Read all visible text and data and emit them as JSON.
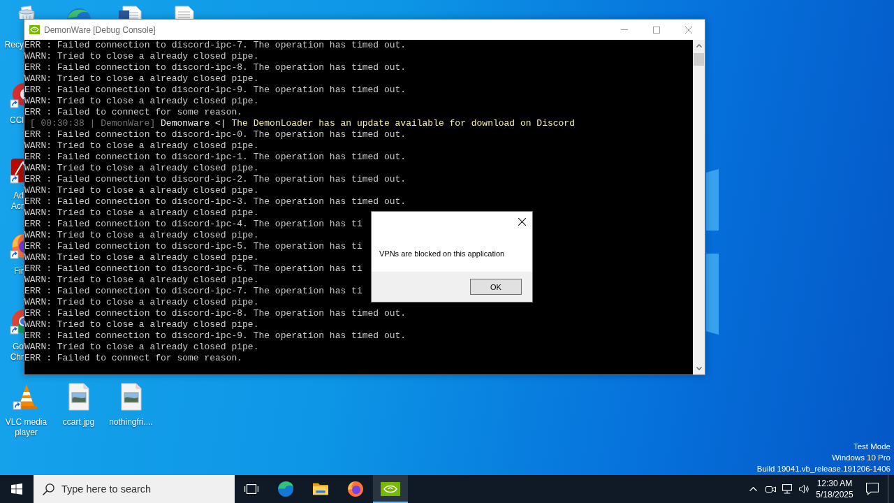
{
  "desktop": {
    "icons": [
      {
        "kind": "recycle-bin",
        "label": "Recy"
      },
      {
        "kind": "edge"
      },
      {
        "kind": "word-document"
      },
      {
        "kind": "text-document"
      },
      {
        "kind": "ccleaner",
        "label": "CCl"
      },
      {
        "kind": "acrobat",
        "label": "Ad Acr"
      },
      {
        "kind": "firefox",
        "label": "Fir"
      },
      {
        "kind": "chrome",
        "label": "Go Chr"
      },
      {
        "kind": "vlc",
        "label": "VLC media player"
      },
      {
        "kind": "image-file",
        "label": "ccart.jpg"
      },
      {
        "kind": "image-file",
        "label": "nothingfri...."
      }
    ],
    "system_info": [
      "Test Mode",
      "Windows 10 Pro",
      "Build 19041.vb_release.191206-1406"
    ]
  },
  "console_window": {
    "title": "DemonWare [Debug Console]",
    "lines": [
      {
        "kind": "log",
        "text": "ERR : Failed connection to discord-ipc-7. The operation has timed out."
      },
      {
        "kind": "log",
        "text": "WARN: Tried to close a already closed pipe."
      },
      {
        "kind": "log",
        "text": "ERR : Failed connection to discord-ipc-8. The operation has timed out."
      },
      {
        "kind": "log",
        "text": "WARN: Tried to close a already closed pipe."
      },
      {
        "kind": "log",
        "text": "ERR : Failed connection to discord-ipc-9. The operation has timed out."
      },
      {
        "kind": "log",
        "text": "WARN: Tried to close a already closed pipe."
      },
      {
        "kind": "log",
        "text": "ERR : Failed to connect for some reason."
      },
      {
        "kind": "notice",
        "timestamp": "[ 00:30:38 | DemonWare]",
        "source": "Demonware <|",
        "message": "The DemonLoader has an update available for download on Discord"
      },
      {
        "kind": "log",
        "text": "ERR : Failed connection to discord-ipc-0. The operation has timed out."
      },
      {
        "kind": "log",
        "text": "WARN: Tried to close a already closed pipe."
      },
      {
        "kind": "log",
        "text": "ERR : Failed connection to discord-ipc-1. The operation has timed out."
      },
      {
        "kind": "log",
        "text": "WARN: Tried to close a already closed pipe."
      },
      {
        "kind": "log",
        "text": "ERR : Failed connection to discord-ipc-2. The operation has timed out."
      },
      {
        "kind": "log",
        "text": "WARN: Tried to close a already closed pipe."
      },
      {
        "kind": "log",
        "text": "ERR : Failed connection to discord-ipc-3. The operation has timed out."
      },
      {
        "kind": "log",
        "text": "WARN: Tried to close a already closed pipe."
      },
      {
        "kind": "log",
        "text": "ERR : Failed connection to discord-ipc-4. The operation has ti"
      },
      {
        "kind": "log",
        "text": "WARN: Tried to close a already closed pipe."
      },
      {
        "kind": "log",
        "text": "ERR : Failed connection to discord-ipc-5. The operation has ti"
      },
      {
        "kind": "log",
        "text": "WARN: Tried to close a already closed pipe."
      },
      {
        "kind": "log",
        "text": "ERR : Failed connection to discord-ipc-6. The operation has ti"
      },
      {
        "kind": "log",
        "text": "WARN: Tried to close a already closed pipe."
      },
      {
        "kind": "log",
        "text": "ERR : Failed connection to discord-ipc-7. The operation has ti"
      },
      {
        "kind": "log",
        "text": "WARN: Tried to close a already closed pipe."
      },
      {
        "kind": "log",
        "text": "ERR : Failed connection to discord-ipc-8. The operation has timed out."
      },
      {
        "kind": "log",
        "text": "WARN: Tried to close a already closed pipe."
      },
      {
        "kind": "log",
        "text": "ERR : Failed connection to discord-ipc-9. The operation has timed out."
      },
      {
        "kind": "log",
        "text": "WARN: Tried to close a already closed pipe."
      },
      {
        "kind": "log",
        "text": "ERR : Failed to connect for some reason."
      }
    ]
  },
  "dialog": {
    "message": "VPNs are blocked on this application",
    "button": "OK"
  },
  "taskbar": {
    "search": {
      "placeholder": "Type here to search"
    },
    "apps": [
      {
        "kind": "task-view",
        "selected": false
      },
      {
        "kind": "edge",
        "selected": false
      },
      {
        "kind": "explorer",
        "selected": false
      },
      {
        "kind": "firefox",
        "selected": false
      },
      {
        "kind": "nvidia",
        "selected": true
      }
    ],
    "clock": {
      "time": "12:30 AM",
      "date": "5/18/2025"
    }
  }
}
